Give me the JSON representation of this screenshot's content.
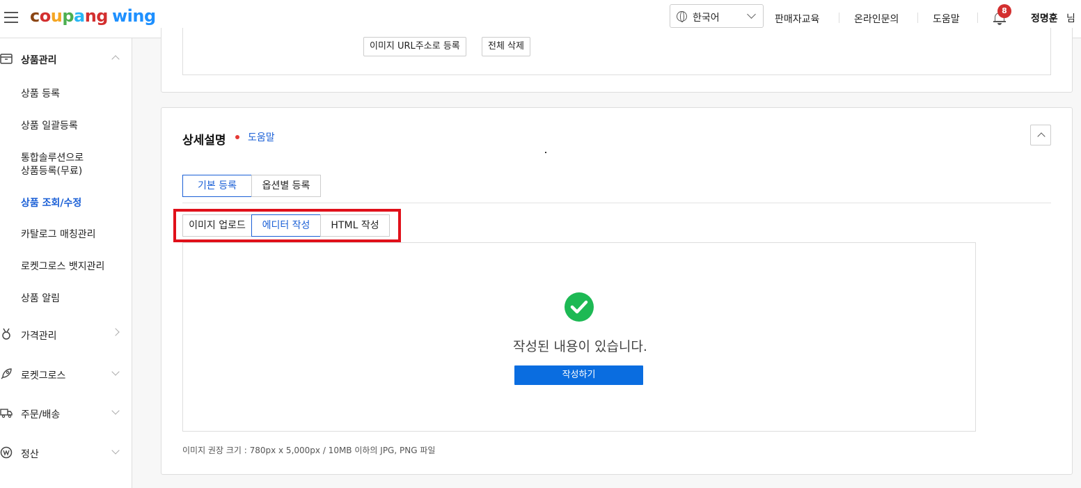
{
  "header": {
    "logo_parts": [
      "c",
      "o",
      "u",
      "p",
      "a",
      "ng"
    ],
    "logo_wing": "wing",
    "language": "한국어",
    "nav": [
      "판매자교육",
      "온라인문의",
      "도움말"
    ],
    "notification_count": "8",
    "user_name": "정명훈",
    "user_suffix": "님"
  },
  "sidebar": {
    "product_mgmt": "상품관리",
    "sub_items": [
      "상품 등록",
      "상품 일괄등록",
      "통합솔루션으로",
      "상품등록(무료)",
      "상품 조회/수정",
      "카탈로그 매칭관리",
      "로켓그로스 뱃지관리",
      "상품 알림"
    ],
    "active_item": "상품 조회/수정",
    "price_mgmt": "가격관리",
    "rocket_growth": "로켓그로스",
    "order_shipping": "주문/배송",
    "settlement": "정산"
  },
  "image_panel": {
    "url_button": "이미지 URL주소로 등록",
    "delete_all_button": "전체 삭제"
  },
  "detail_section": {
    "title": "상세설명",
    "help_link": "도움말",
    "mode_tabs": [
      "기본 등록",
      "옵션별 등록"
    ],
    "active_mode_tab": "기본 등록",
    "editor_tabs": [
      "이미지 업로드",
      "에디터 작성",
      "HTML 작성"
    ],
    "active_editor_tab": "에디터 작성",
    "status_message": "작성된 내용이 있습니다.",
    "write_button": "작성하기",
    "hint": "이미지 권장 크기 : 780px x 5,000px / 10MB 이하의 JPG, PNG 파일"
  },
  "colors": {
    "accent": "#1a5fd6",
    "primary_button": "#0a6de0",
    "highlight_border": "#e0101a",
    "check_green": "#1db954",
    "badge_red": "#d32f2f"
  }
}
